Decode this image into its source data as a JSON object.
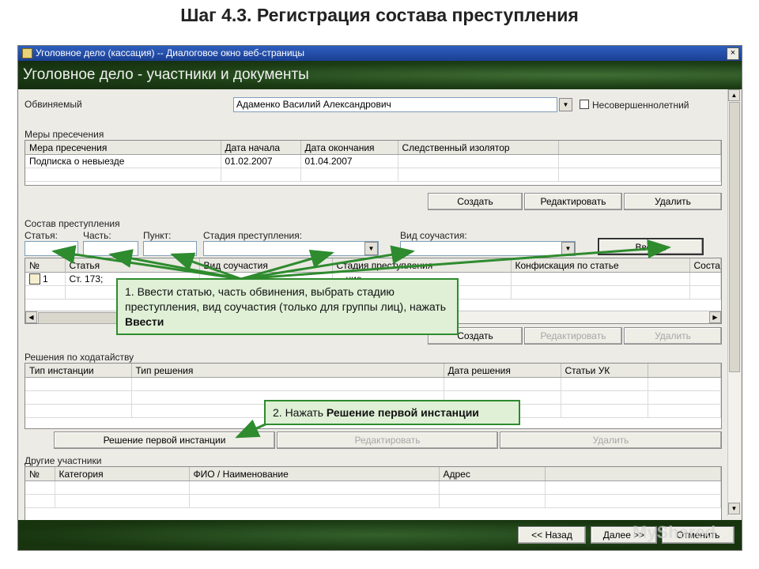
{
  "slide": {
    "title": "Шаг 4.3. Регистрация состава преступления"
  },
  "window": {
    "title": "Уголовное дело (кассация) -- Диалоговое окно веб-страницы",
    "close": "×",
    "banner": "Уголовное дело - участники и документы"
  },
  "accused": {
    "label": "Обвиняемый",
    "value": "Адаменко Василий Александрович",
    "minor_label": "Несовершеннолетний"
  },
  "measures": {
    "title": "Меры пресечения",
    "columns": [
      "Мера пресечения",
      "Дата начала",
      "Дата окончания",
      "Следственный изолятор"
    ],
    "rows": [
      [
        "Подписка о невыезде",
        "01.02.2007",
        "01.04.2007",
        ""
      ]
    ],
    "buttons": {
      "create": "Создать",
      "edit": "Редактировать",
      "delete": "Удалить"
    }
  },
  "crime": {
    "title": "Состав преступления",
    "article_label": "Статья:",
    "part_label": "Часть:",
    "point_label": "Пункт:",
    "stage_label": "Стадия преступления:",
    "complicity_label": "Вид соучастия:",
    "enter_button": "Ввести",
    "columns": [
      "№",
      "Статья",
      "Вид соучастия",
      "Стадия преступления",
      "Конфискация по статье",
      "Соста"
    ],
    "rows": [
      [
        "1",
        "Ст. 173;",
        "",
        "…ние",
        "",
        ""
      ]
    ],
    "buttons": {
      "create": "Создать",
      "edit": "Редактировать",
      "delete": "Удалить"
    }
  },
  "petitions": {
    "title": "Решения по ходатайству",
    "columns": [
      "Тип инстанции",
      "Тип решения",
      "Дата решения",
      "Статьи УК"
    ],
    "buttons": {
      "first_instance": "Решение первой инстанции",
      "edit": "Редактировать",
      "delete": "Удалить"
    }
  },
  "participants": {
    "title": "Другие участники",
    "columns": [
      "№",
      "Категория",
      "ФИО / Наименование",
      "Адрес"
    ]
  },
  "footer": {
    "back": "<< Назад",
    "next": "Далее >>",
    "cancel": "Отменить"
  },
  "callouts": {
    "step1_text": "1. Ввести статью, часть обвинения, выбрать стадию преступления, вид соучастия (только для группы лиц), нажать ",
    "step1_bold": "Ввести",
    "step2_text": "2. Нажать ",
    "step2_bold": "Решение первой инстанции"
  },
  "watermark": "MyShared",
  "colors": {
    "banner": "#1c3d15",
    "callout_border": "#2e8b2e",
    "callout_bg": "#dff0d6",
    "titlebar": "#2e5fbf"
  }
}
